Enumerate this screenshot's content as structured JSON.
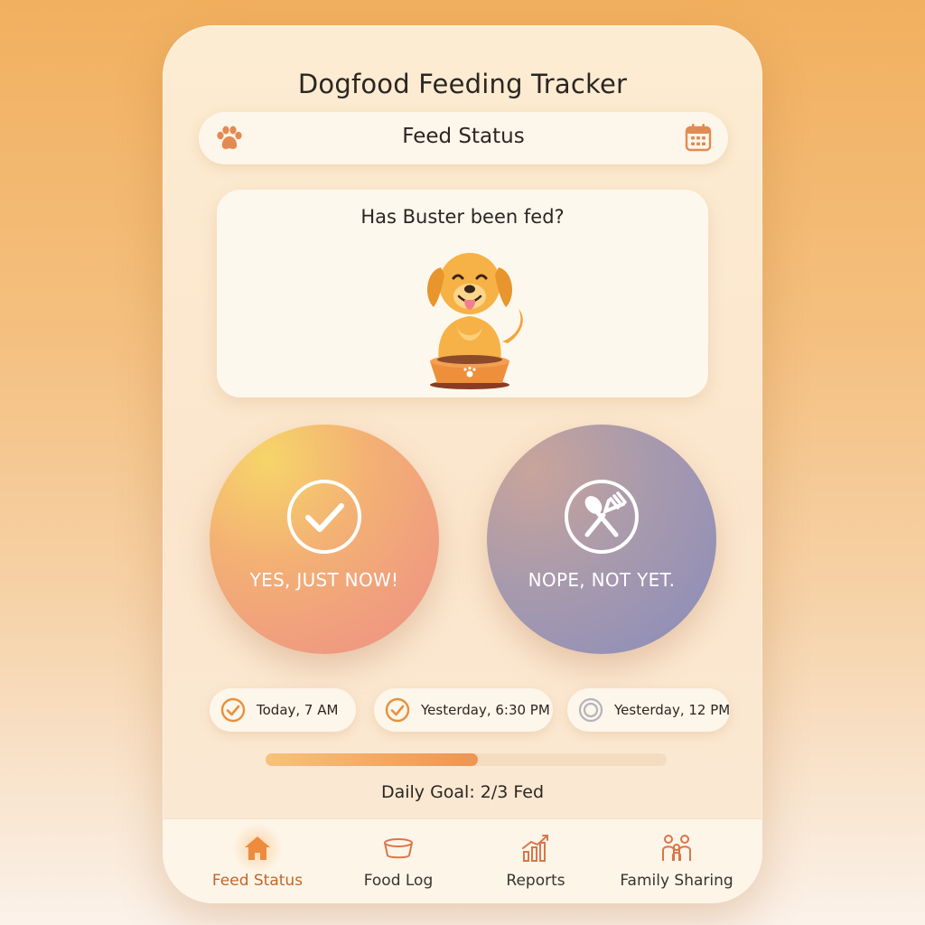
{
  "app": {
    "title": "Dogfood Feeding Tracker"
  },
  "status_bar": {
    "label": "Feed Status",
    "left_icon": "paw-icon",
    "right_icon": "calendar-icon"
  },
  "question": {
    "text": "Has Buster been fed?",
    "illustration": "golden-retriever-with-bowl"
  },
  "actions": {
    "yes": {
      "label": "YES, JUST NOW!",
      "icon": "check-circle-icon"
    },
    "no": {
      "label": "NOPE, NOT YET.",
      "icon": "utensils-circle-icon"
    }
  },
  "history": [
    {
      "text": "Today, 7 AM",
      "icon": "check-circle-icon",
      "status": "fed"
    },
    {
      "text": "Yesterday, 6:30 PM",
      "icon": "check-circle-icon",
      "status": "fed"
    },
    {
      "text": "Yesterday, 12 PM",
      "icon": "empty-circle-icon",
      "status": "missed"
    }
  ],
  "goal": {
    "text": "Daily Goal: 2/3 Fed",
    "fed": 2,
    "total": 3,
    "progress_fraction": 0.53
  },
  "nav": [
    {
      "label": "Feed Status",
      "icon": "home-icon",
      "active": true
    },
    {
      "label": "Food Log",
      "icon": "bowl-icon",
      "active": false
    },
    {
      "label": "Reports",
      "icon": "chart-icon",
      "active": false
    },
    {
      "label": "Family Sharing",
      "icon": "family-icon",
      "active": false
    }
  ],
  "colors": {
    "accent": "#ee9453",
    "accent_dark": "#c0652c",
    "text": "#2b2622",
    "yes_gradient": [
      "#f6d56a",
      "#ee8f87"
    ],
    "no_gradient": [
      "#c9a49a",
      "#8a8cbb"
    ]
  }
}
